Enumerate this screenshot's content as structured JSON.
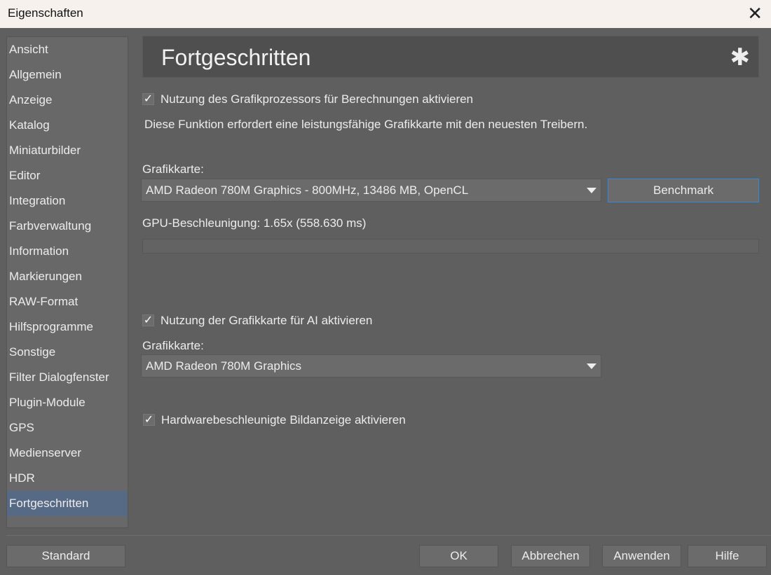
{
  "window": {
    "title": "Eigenschaften",
    "close_icon": "close-icon"
  },
  "sidebar": {
    "items": [
      "Ansicht",
      "Allgemein",
      "Anzeige",
      "Katalog",
      "Miniaturbilder",
      "Editor",
      "Integration",
      "Farbverwaltung",
      "Information",
      "Markierungen",
      "RAW-Format",
      "Hilfsprogramme",
      "Sonstige",
      "Filter Dialogfenster",
      "Plugin-Module",
      "GPS",
      "Medienserver",
      "HDR",
      "Fortgeschritten"
    ],
    "selected": "Fortgeschritten"
  },
  "header": {
    "title": "Fortgeschritten",
    "icon": "gear-icon"
  },
  "gpu_compute": {
    "checkbox_label": "Nutzung des Grafikprozessors für Berechnungen aktivieren",
    "checked": true,
    "note": "Diese Funktion erfordert eine leistungsfähige Grafikkarte mit den neuesten Treibern.",
    "card_label": "Grafikkarte:",
    "card_value": "AMD Radeon 780M Graphics - 800MHz, 13486 MB, OpenCL",
    "benchmark_label": "Benchmark",
    "result": "GPU-Beschleunigung: 1.65x (558.630 ms)",
    "progress": 0
  },
  "gpu_ai": {
    "checkbox_label": "Nutzung der Grafikkarte für AI aktivieren",
    "checked": true,
    "card_label": "Grafikkarte:",
    "card_value": "AMD Radeon 780M Graphics"
  },
  "hw_display": {
    "checkbox_label": "Hardwarebeschleunigte Bildanzeige aktivieren",
    "checked": true
  },
  "footer": {
    "standard": "Standard",
    "ok": "OK",
    "cancel": "Abbrechen",
    "apply": "Anwenden",
    "help": "Hilfe"
  },
  "colors": {
    "background": "#5f5f5f",
    "sidebar": "#686868",
    "selected": "#566a85",
    "focus": "#3a86d6"
  }
}
